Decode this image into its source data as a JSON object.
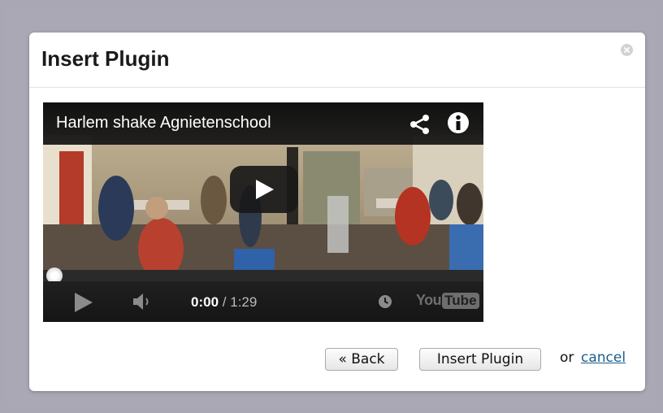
{
  "dialog": {
    "title": "Insert Plugin",
    "close_icon": "close-circle-icon"
  },
  "video": {
    "title": "Harlem shake Agnietenschool",
    "share_icon": "share-icon",
    "info_icon": "info-icon",
    "play_overlay_icon": "play-icon",
    "current_time": "0:00",
    "separator": "/",
    "duration": "1:29",
    "progress": 0,
    "brand_you": "You",
    "brand_tube": "Tube"
  },
  "footer": {
    "back_label": "« Back",
    "insert_label": "Insert Plugin",
    "or_text": "or",
    "cancel_label": "cancel"
  },
  "colors": {
    "backdrop": "#a8a7b3",
    "link": "#1a5e8e",
    "player_bg": "#1b1b1b"
  }
}
